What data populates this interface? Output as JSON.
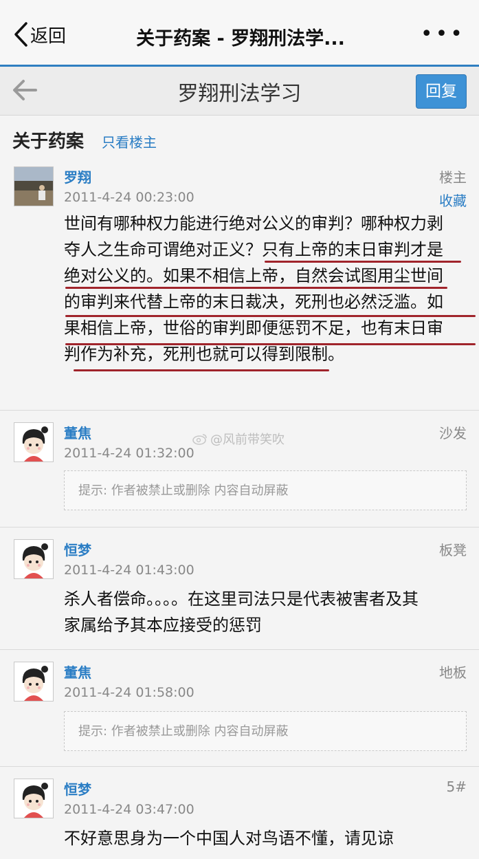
{
  "topbar": {
    "back_label": "返回",
    "title": "关于药案 - 罗翔刑法学...",
    "more": "•••"
  },
  "forum": {
    "title": "罗翔刑法学习",
    "reply_label": "回复"
  },
  "thread": {
    "title": "关于药案",
    "only_op_label": "只看楼主"
  },
  "watermark": "@风前带笑吹",
  "posts": [
    {
      "author": "罗翔",
      "time": "2011-4-24 00:23:00",
      "floor": "楼主",
      "collect": "收藏",
      "lines": [
        "世间有哪种权力能进行绝对公义的审判？哪种权力剥",
        "夺人之生命可谓绝对正义？只有上帝的末日审判才是",
        "绝对公义的。如果不相信上帝，自然会试图用尘世间",
        "的审判来代替上帝的末日裁决，死刑也必然泛滥。如",
        "果相信上帝，世俗的审判即便惩罚不足，也有末日审",
        "判作为补充，死刑也就可以得到限制。"
      ]
    },
    {
      "author": "董焦",
      "time": "2011-4-24 01:32:00",
      "floor": "沙发",
      "notice": "提示: 作者被禁止或删除 内容自动屏蔽"
    },
    {
      "author": "恒梦",
      "time": "2011-4-24 01:43:00",
      "floor": "板凳",
      "lines": [
        "杀人者偿命。。。。在这里司法只是代表被害者及其",
        "家属给予其本应接受的惩罚"
      ]
    },
    {
      "author": "董焦",
      "time": "2011-4-24 01:58:00",
      "floor": "地板",
      "notice": "提示: 作者被禁止或删除 内容自动屏蔽"
    },
    {
      "author": "恒梦",
      "time": "2011-4-24 03:47:00",
      "floor": "5#",
      "lines": [
        "不好意思身为一个中国人对鸟语不懂，请见谅"
      ]
    }
  ],
  "colors": {
    "accent": "#2a7dc4",
    "reply_button": "#3e92d6",
    "underline": "#a0242b"
  }
}
